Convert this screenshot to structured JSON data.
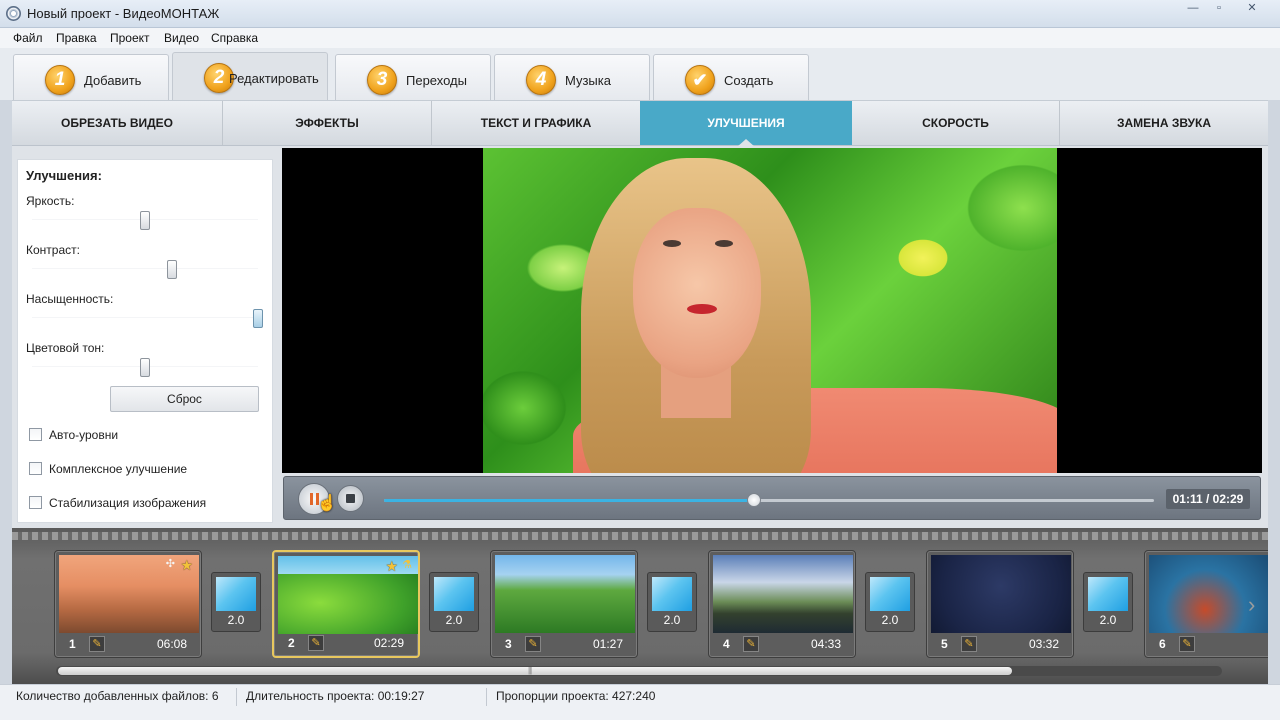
{
  "window": {
    "title": "Новый проект - ВидеоМОНТАЖ",
    "min": "—",
    "max": "▫",
    "close": "✕"
  },
  "menu": [
    "Файл",
    "Правка",
    "Проект",
    "Видео",
    "Справка"
  ],
  "steps": [
    {
      "num": "1",
      "label": "Добавить"
    },
    {
      "num": "2",
      "label": "Редактировать"
    },
    {
      "num": "3",
      "label": "Переходы"
    },
    {
      "num": "4",
      "label": "Музыка"
    },
    {
      "num": "✔",
      "label": "Создать"
    }
  ],
  "active_step": 1,
  "subtabs": [
    "ОБРЕЗАТЬ ВИДЕО",
    "ЭФФЕКТЫ",
    "ТЕКСТ И ГРАФИКА",
    "УЛУЧШЕНИЯ",
    "СКОРОСТЬ",
    "ЗАМЕНА ЗВУКА"
  ],
  "active_subtab": 3,
  "panel": {
    "title": "Улучшения:",
    "sliders": [
      {
        "label": "Яркость:",
        "value": 0.5
      },
      {
        "label": "Контраст:",
        "value": 0.62
      },
      {
        "label": "Насыщенность:",
        "value": 1.0
      },
      {
        "label": "Цветовой тон:",
        "value": 0.5
      }
    ],
    "reset_label": "Сброс",
    "checkboxes": [
      {
        "label": "Авто-уровни",
        "checked": false
      },
      {
        "label": "Комплексное улучшение",
        "checked": false
      },
      {
        "label": "Стабилизация изображения",
        "checked": false
      }
    ]
  },
  "player": {
    "time": "01:11 / 02:29",
    "progress": 0.48
  },
  "clips": [
    {
      "num": "1",
      "duration": "06:08",
      "thumb": "t1",
      "selected": false
    },
    {
      "num": "2",
      "duration": "02:29",
      "thumb": "t2",
      "selected": true
    },
    {
      "num": "3",
      "duration": "01:27",
      "thumb": "t3",
      "selected": false
    },
    {
      "num": "4",
      "duration": "04:33",
      "thumb": "t4",
      "selected": false
    },
    {
      "num": "5",
      "duration": "03:32",
      "thumb": "t5",
      "selected": false
    },
    {
      "num": "6",
      "duration": "",
      "thumb": "t6",
      "selected": false
    }
  ],
  "transitions": [
    "2.0",
    "2.0",
    "2.0",
    "2.0",
    "2.0"
  ],
  "status": {
    "files": "Количество добавленных файлов: 6",
    "duration": "Длительность проекта:  00:19:27",
    "aspect": "Пропорции проекта:  427:240"
  },
  "colors": {
    "accent": "#49a9c8",
    "progress": "#3bb3e3",
    "selected_clip": "#e8c85e"
  }
}
